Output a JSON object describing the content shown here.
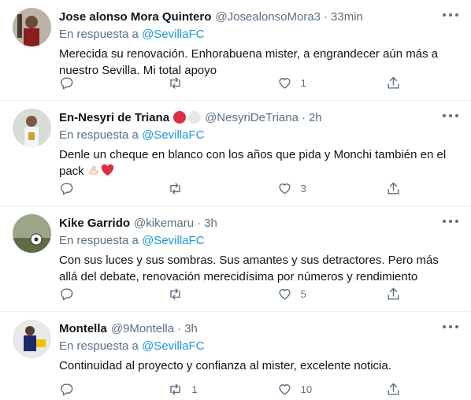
{
  "tweets": [
    {
      "name": "Jose alonso Mora Quintero",
      "handle": "@JosealonsoMora3",
      "time": "33min",
      "reply_prefix": "En respuesta a",
      "reply_handle": "@SevillaFC",
      "text": "Merecida su renovación. Enhorabuena mister, a engrandecer aún más a nuestro Sevilla. Mi total apoyo",
      "replies": "",
      "retweets": "",
      "likes": "1"
    },
    {
      "name": "En-Nesyri de Triana",
      "handle": "@NesyriDeTriana",
      "time": "2h",
      "reply_prefix": "En respuesta a",
      "reply_handle": "@SevillaFC",
      "text": "Denle un cheque en blanco con los años que pida y Monchi también en el pack",
      "replies": "",
      "retweets": "",
      "likes": "3"
    },
    {
      "name": "Kike Garrido",
      "handle": "@kikemaru",
      "time": "3h",
      "reply_prefix": "En respuesta a",
      "reply_handle": "@SevillaFC",
      "text": "Con sus luces y sus sombras. Sus amantes y sus detractores. Pero más allá del debate, renovación merecidísima por números y rendimiento",
      "replies": "",
      "retweets": "",
      "likes": "5"
    },
    {
      "name": "Montella",
      "handle": "@9Montella",
      "time": "3h",
      "reply_prefix": "En respuesta a",
      "reply_handle": "@SevillaFC",
      "text": "Continuidad al proyecto y confianza al mister, excelente noticia.",
      "replies": "",
      "retweets": "1",
      "likes": "10"
    }
  ],
  "separator": "·",
  "icons": {
    "reply": "reply-icon",
    "retweet": "retweet-icon",
    "like": "heart-icon",
    "share": "share-icon",
    "more": "more-icon"
  },
  "colors": {
    "link": "#1b95e0",
    "secondary": "#5b7083",
    "border": "#ebeef0"
  }
}
